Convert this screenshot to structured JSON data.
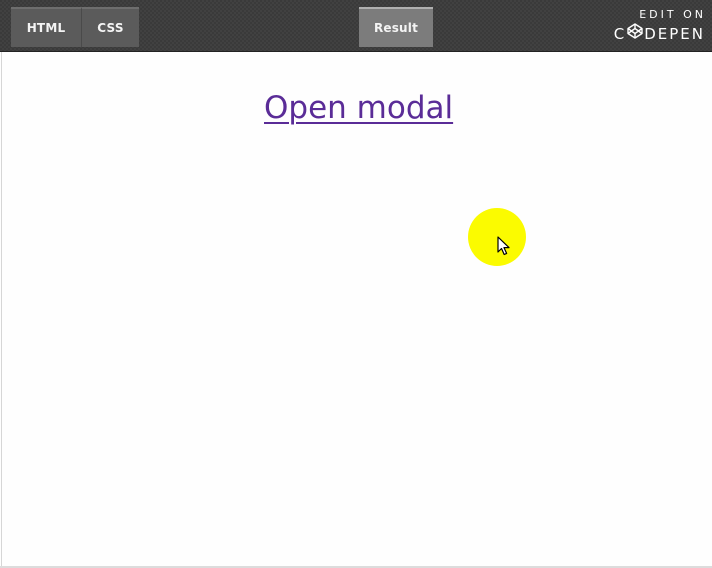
{
  "toolbar": {
    "tabs": [
      {
        "label": "HTML"
      },
      {
        "label": "CSS"
      },
      {
        "label": "Result"
      }
    ],
    "edit_on": {
      "line1": "EDIT ON",
      "brand_prefix": "C",
      "brand_suffix": "DEPEN",
      "icon": "codepen-logo-icon"
    }
  },
  "result": {
    "link_text": "Open modal"
  },
  "cursor": {
    "icon": "mouse-pointer-icon",
    "highlight_color": "#fbfb00"
  },
  "colors": {
    "topbar": "#3a3a3a",
    "link": "#5a2c97",
    "background": "#fefefe"
  }
}
